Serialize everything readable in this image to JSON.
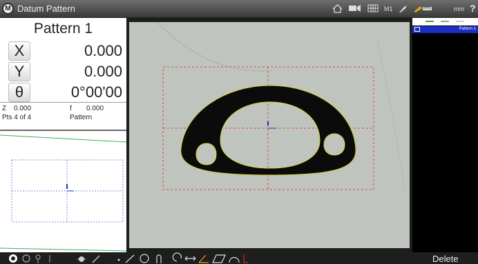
{
  "titlebar": {
    "logo": "M",
    "title": "Datum Pattern",
    "magnification": "M1",
    "units": "mm",
    "help": "?",
    "icons": [
      "home-icon",
      "camera-icon",
      "grid-icon",
      "probe-icon",
      "ruler-icon",
      "help-icon"
    ]
  },
  "dro": {
    "pattern_name": "Pattern 1",
    "x_label": "X",
    "x_value": "0.000",
    "y_label": "Y",
    "y_value": "0.000",
    "theta_label": "θ",
    "theta_value": "0°00'00",
    "z_label": "Z",
    "z_value": "0.000",
    "f_label": "f",
    "f_value": "0.000",
    "points": "Pts 4 of 4",
    "feature_type": "Pattern"
  },
  "feature_list": {
    "items": [
      {
        "label": "Pattern 1",
        "selected": true
      }
    ],
    "header_colors": [
      "#2aa84a",
      "#9a9a9a",
      "#cfcfcf"
    ]
  },
  "toolbar": {
    "delete_label": "Delete",
    "tools": [
      "hand-probe-icon",
      "edge-probe-icon",
      "crosshair-probe-icon",
      "cursor-icon",
      "light-icon",
      "line-icon",
      "point-tool-icon",
      "line-tool-icon",
      "circle-tool-icon",
      "slot-tool-icon",
      "arc-tool-icon",
      "distance-tool-icon",
      "angle-tool-icon",
      "plane-tool-icon",
      "curve-tool-icon",
      "datum-tool-icon"
    ]
  },
  "colors": {
    "selection_blue": "#1a2fc4",
    "measure_red": "#e2231a",
    "part_green": "#2bb55a",
    "edge_yellow": "#d8d23a"
  }
}
